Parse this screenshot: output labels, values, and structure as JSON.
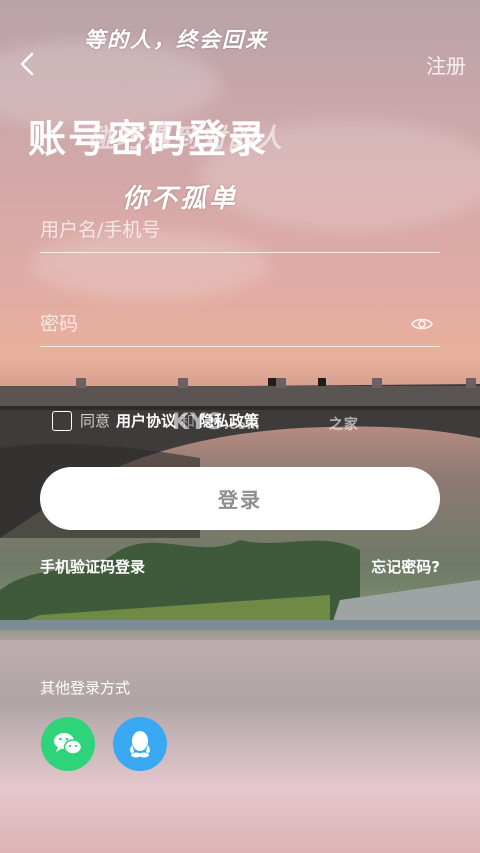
{
  "header": {
    "tagline": "等的人，终会回来",
    "register_label": "注册"
  },
  "hero": {
    "title": "账号密码登录",
    "title_overlay": "碰巧遇到对的人",
    "slogan": "你不孤单"
  },
  "form": {
    "username_placeholder": "用户名/手机号",
    "password_placeholder": "密码"
  },
  "agreement": {
    "prefix": "同意",
    "user_agreement": "用户协议",
    "and": "和",
    "privacy_policy": "隐私政策",
    "watermark_text": "KYS",
    "watermark_sub": ".com",
    "watermark_extra": "之家"
  },
  "actions": {
    "login_label": "登录",
    "sms_login_label": "手机验证码登录",
    "forgot_password_label": "忘记密码?"
  },
  "other_login": {
    "label": "其他登录方式",
    "methods": [
      {
        "name": "wechat",
        "color": "#2fd37a"
      },
      {
        "name": "qq",
        "color": "#39a8f3"
      }
    ]
  },
  "colors": {
    "button_text": "#8e8e8e",
    "wechat": "#2fd37a",
    "qq": "#39a8f3"
  }
}
